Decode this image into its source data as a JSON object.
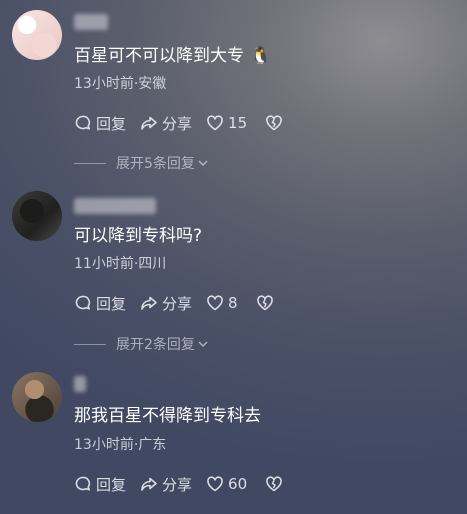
{
  "comments": [
    {
      "text": "百星可不可以降到大专",
      "emoji": "🐧",
      "meta": "13小时前·安徽",
      "reply_label": "回复",
      "share_label": "分享",
      "likes": "15",
      "replies": "展开5条回复"
    },
    {
      "text": "可以降到专科吗?",
      "meta": "11小时前·四川",
      "reply_label": "回复",
      "share_label": "分享",
      "likes": "8",
      "replies": "展开2条回复"
    },
    {
      "text": "那我百星不得降到专科去",
      "meta": "13小时前·广东",
      "reply_label": "回复",
      "share_label": "分享",
      "likes": "60"
    }
  ],
  "icons": {
    "reply": "speech-bubble-icon",
    "share": "share-arrow-icon",
    "like": "heart-icon",
    "dislike": "broken-heart-icon",
    "expand": "chevron-down-icon"
  }
}
